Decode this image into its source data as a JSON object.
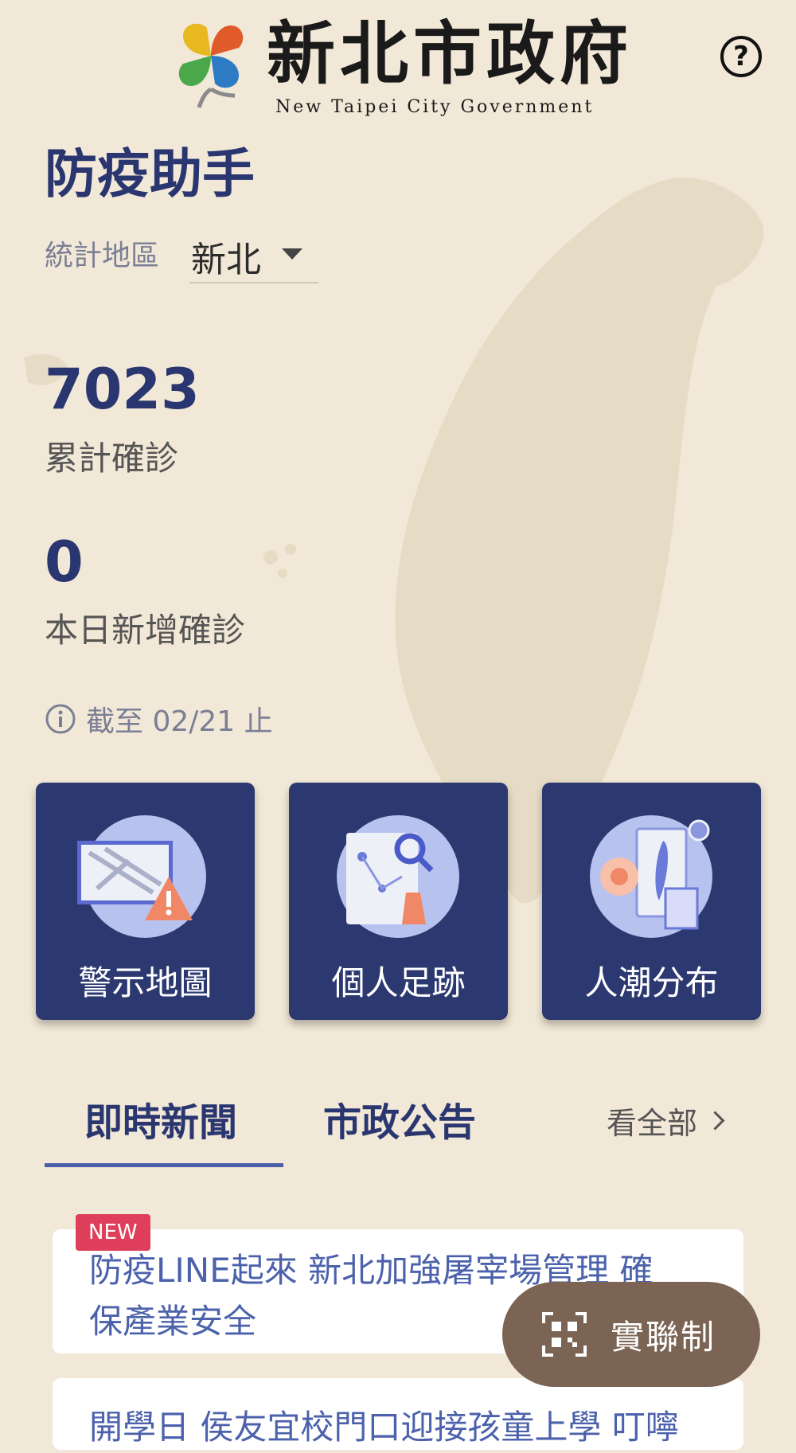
{
  "header": {
    "brand_zh": "新北市政府",
    "brand_en": "New Taipei City Government",
    "help_symbol": "?"
  },
  "page_title": "防疫助手",
  "region": {
    "label": "統計地區",
    "value": "新北"
  },
  "stats": {
    "cumulative": {
      "value": "7023",
      "label": "累計確診"
    },
    "today": {
      "value": "0",
      "label": "本日新增確診"
    }
  },
  "as_of": "截至 02/21 止",
  "tiles": [
    {
      "label": "警示地圖",
      "icon": "warning-map-icon"
    },
    {
      "label": "個人足跡",
      "icon": "footprint-icon"
    },
    {
      "label": "人潮分布",
      "icon": "crowd-distribution-icon"
    }
  ],
  "tabs": [
    {
      "label": "即時新聞",
      "active": true
    },
    {
      "label": "市政公告",
      "active": false
    }
  ],
  "see_all": "看全部",
  "news": [
    {
      "badge": "NEW",
      "line1": "防疫LINE起來 新北加強屠宰場管理 確",
      "line2": "保產業安全"
    },
    {
      "line1": "開學日 侯友宜校門口迎接孩童上學 叮嚀"
    }
  ],
  "fab": {
    "label": "實聯制",
    "icon": "qr-code-icon"
  },
  "colors": {
    "background": "#f2e8d7",
    "primary": "#2c3870",
    "badge": "#df3f5a",
    "fab": "#7b6454"
  }
}
